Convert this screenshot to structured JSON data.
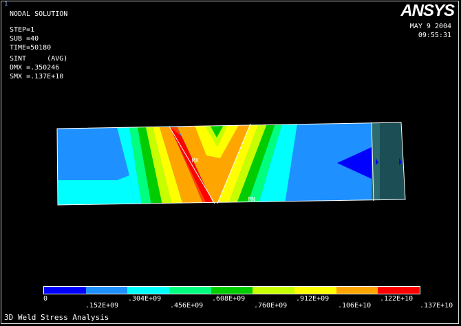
{
  "window": {
    "number": "1",
    "logo": "ANSYS",
    "date": "MAY  9 2004",
    "time": "09:55:31"
  },
  "info": {
    "title": "NODAL SOLUTION",
    "lines": [
      "STEP=1",
      "SUB =40",
      "TIME=50180",
      "SINT     (AVG)",
      "DMX =.350246",
      "SMX =.137E+10"
    ]
  },
  "plot": {
    "markers": [
      "MX",
      "MN"
    ]
  },
  "legend": {
    "colors": [
      "#0000ff",
      "#1e90ff",
      "#00ffff",
      "#00ff7f",
      "#00cc00",
      "#c8ff00",
      "#ffff00",
      "#ffa500",
      "#ff0000"
    ],
    "labels_bottom": [
      "0",
      ".304E+09",
      ".608E+09",
      ".912E+09",
      ".122E+10"
    ],
    "labels_top": [
      ".152E+09",
      ".456E+09",
      ".760E+09",
      ".106E+10",
      ".137E+10"
    ]
  },
  "caption": "3D Weld Stress Analysis"
}
